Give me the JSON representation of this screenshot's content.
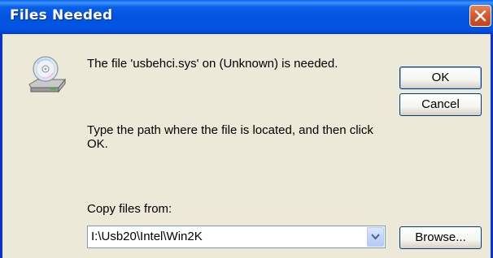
{
  "window": {
    "title": "Files Needed"
  },
  "message": {
    "line1": "The file 'usbehci.sys' on (Unknown) is needed.",
    "line2": "Type the path where the file is located, and then click OK."
  },
  "buttons": {
    "ok": "OK",
    "cancel": "Cancel",
    "browse": "Browse..."
  },
  "copy_from": {
    "label": "Copy files from:",
    "value": "I:\\Usb20\\Intel\\Win2K"
  },
  "icons": {
    "dialog_icon": "cd-drive-icon",
    "close": "close-icon",
    "dropdown": "chevron-down-icon"
  },
  "colors": {
    "titlebar": "#0254e4",
    "close_button": "#d95a2c",
    "dialog_background": "#ece9d8"
  }
}
